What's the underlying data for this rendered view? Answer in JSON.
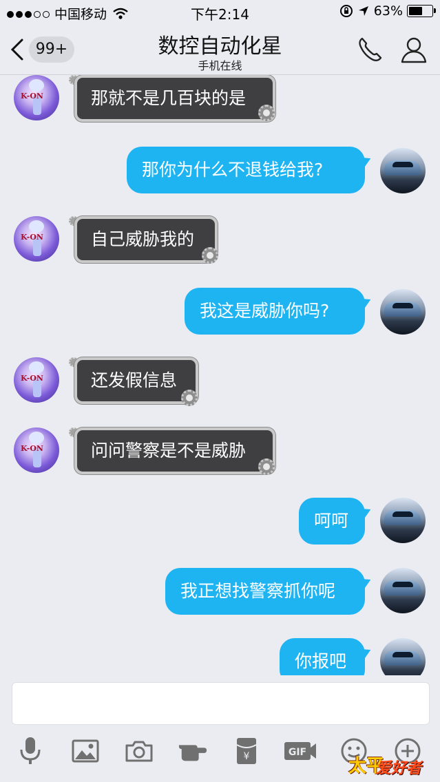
{
  "status_bar": {
    "carrier": "中国移动",
    "time": "下午2:14",
    "battery": "63%",
    "battery_level": 0.63,
    "signal_bars_filled": 3,
    "signal_bars_total": 5
  },
  "nav": {
    "badge": "99+",
    "title": "数控自动化星",
    "subtitle": "手机在线"
  },
  "messages": [
    {
      "side": "left",
      "text": "那就不是几百块的是"
    },
    {
      "side": "right",
      "text": "那你为什么不退钱给我?"
    },
    {
      "side": "left",
      "text": "自己威胁我的"
    },
    {
      "side": "right",
      "text": "我这是威胁你吗?"
    },
    {
      "side": "left",
      "text": "还发假信息"
    },
    {
      "side": "left",
      "text": "问问警察是不是威胁"
    },
    {
      "side": "right",
      "text": "呵呵"
    },
    {
      "side": "right",
      "text": "我正想找警察抓你呢"
    },
    {
      "side": "right",
      "text": "你报吧"
    }
  ],
  "avatar_left_text": "K-ON",
  "toolbar": {
    "gif_label": "GIF",
    "hongbao_label": "¥"
  },
  "watermark": {
    "part1": "太平",
    "part2": "爱好者"
  },
  "colors": {
    "accent_blue": "#1eb4f2",
    "bubble_dark": "#3f3f41",
    "background": "#ebecf1"
  }
}
